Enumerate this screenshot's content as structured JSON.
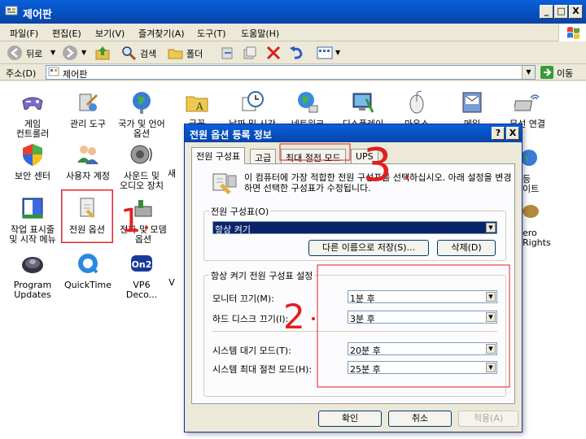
{
  "window": {
    "title": "제어판"
  },
  "menu": [
    "파일(F)",
    "편집(E)",
    "보기(V)",
    "즐겨찾기(A)",
    "도구(T)",
    "도움말(H)"
  ],
  "toolbar": {
    "back": "뒤로",
    "search": "검색",
    "folders": "폴더"
  },
  "address": {
    "label": "주소(D)",
    "value": "제어판",
    "go": "이동"
  },
  "control_panel": {
    "items": [
      {
        "label": "게임\n컨트롤러",
        "icon": "gamepad-icon"
      },
      {
        "label": "관리 도구",
        "icon": "admin-tools-icon"
      },
      {
        "label": "국가 및 언어\n옵션",
        "icon": "globe-icon"
      },
      {
        "label": "글꼴",
        "icon": "fonts-folder-icon"
      },
      {
        "label": "날짜 및 시간",
        "icon": "clock-icon"
      },
      {
        "label": "네트워크",
        "icon": "network-icon"
      },
      {
        "label": "디스플레이",
        "icon": "display-icon"
      },
      {
        "label": "마우스",
        "icon": "mouse-icon"
      },
      {
        "label": "메일",
        "icon": "mail-icon"
      },
      {
        "label": "무선 연결",
        "icon": "wireless-icon"
      },
      {
        "label": "보안 센터",
        "icon": "shield-icon"
      },
      {
        "label": "사용자 계정",
        "icon": "users-icon"
      },
      {
        "label": "사운드 및\n오디오 장치",
        "icon": "speaker-icon"
      },
      {
        "label": "새",
        "icon": "new-hardware-icon"
      },
      {
        "label": "작업 표시줄\n및 시작 메뉴",
        "icon": "taskbar-icon"
      },
      {
        "label": "전원 옵션",
        "icon": "power-options-icon"
      },
      {
        "label": "전화 및 모뎀\n옵션",
        "icon": "phone-modem-icon"
      },
      {
        "label": "Program\nUpdates",
        "icon": "program-updates-icon"
      },
      {
        "label": "QuickTime",
        "icon": "quicktime-icon"
      },
      {
        "label": "VP6\nDeco...",
        "icon": "vp6-icon"
      },
      {
        "label": "V",
        "icon": "v-icon"
      },
      {
        "label": "등\n이트",
        "icon": "partial-globe-icon"
      },
      {
        "label": "ero\nRights",
        "icon": "partial-rights-icon"
      }
    ]
  },
  "dialog": {
    "title": "전원 옵션 등록 정보",
    "help_btn": "?",
    "close_btn": "X",
    "tabs": [
      "전원 구성표",
      "고급",
      "최대 절전 모드",
      "UPS"
    ],
    "description": "이 컴퓨터에 가장 적합한 전원 구성표를 선택하십시오. 아래 설정을 변경하면 선택한 구성표가 수정됩니다.",
    "scheme_group": {
      "label": "전원 구성표(O)",
      "selected": "항상 켜기",
      "save_as": "다른 이름으로 저장(S)...",
      "delete": "삭제(D)"
    },
    "settings_group": {
      "label": "항상 켜기 전원 구성표 설정",
      "rows": [
        {
          "label": "모니터 끄기(M):",
          "value": "1분 후"
        },
        {
          "label": "하드 디스크 끄기(I):",
          "value": "3분 후"
        },
        {
          "label": "시스템 대기 모드(T):",
          "value": "20분 후"
        },
        {
          "label": "시스템 최대 절전 모드(H):",
          "value": "25분 후"
        }
      ]
    },
    "ok": "확인",
    "cancel": "취소",
    "apply": "적용(A)"
  },
  "annotations": {
    "one": "1",
    "two": "2",
    "three": "3",
    "color": "#e02020"
  }
}
